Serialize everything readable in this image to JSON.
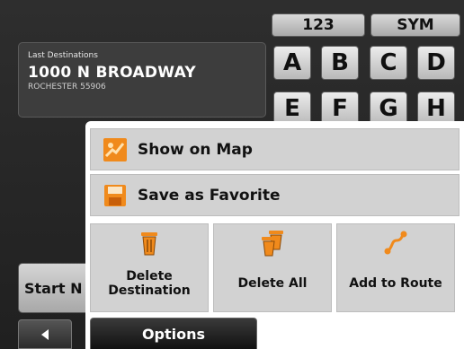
{
  "keyboard": {
    "mode_keys": [
      "123",
      "SYM"
    ],
    "letters": [
      "A",
      "B",
      "C",
      "D",
      "E",
      "F",
      "G",
      "H"
    ]
  },
  "last_destination": {
    "caption": "Last Destinations",
    "address": "1000 N BROADWAY",
    "city": "ROCHESTER 55906"
  },
  "start_button": {
    "label": "Start N"
  },
  "options_menu": {
    "show_on_map": "Show on Map",
    "save_as_favorite": "Save as Favorite",
    "delete_destination": "Delete\nDestination",
    "delete_all": "Delete All",
    "add_to_route": "Add to Route",
    "tab_label": "Options"
  },
  "colors": {
    "background": "#202020",
    "key_face": "#d9d9d9",
    "popup_background": "#ffffff",
    "option_button": "#d2d2d2",
    "icon_orange": "#f08a1c"
  },
  "icons": {
    "show_on_map": "map-icon",
    "save_as_favorite": "floppy-icon",
    "delete_destination": "trash-icon",
    "delete_all": "trash-stack-icon",
    "add_to_route": "route-icon",
    "back": "left-arrow-icon"
  }
}
